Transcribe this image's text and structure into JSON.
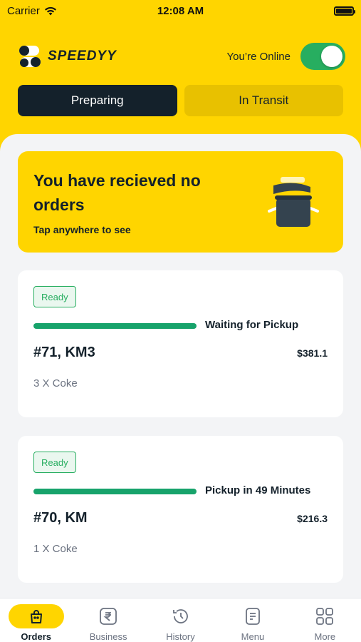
{
  "status_bar": {
    "carrier": "Carrier",
    "time": "12:08 AM"
  },
  "header": {
    "brand": "SPEEDYY",
    "online_label": "You’re Online",
    "online": true
  },
  "tabs": [
    {
      "label": "Preparing",
      "active": true
    },
    {
      "label": "In Transit",
      "active": false
    }
  ],
  "banner": {
    "title": "You have recieved no orders",
    "subtitle": "Tap anywhere to see",
    "icon": "cooking-pot-icon"
  },
  "orders": [
    {
      "badge": "Ready",
      "status": "Waiting for Pickup",
      "id": "#71, KM3",
      "price": "$381.1",
      "items": "3 X Coke",
      "progress": 1.0
    },
    {
      "badge": "Ready",
      "status": "Pickup in 49 Minutes",
      "id": "#70, KM",
      "price": "$216.3",
      "items": "1 X Coke",
      "progress": 1.0
    }
  ],
  "nav": [
    {
      "label": "Orders",
      "icon": "bag-icon",
      "active": true
    },
    {
      "label": "Business",
      "icon": "rupee-icon",
      "active": false
    },
    {
      "label": "History",
      "icon": "history-icon",
      "active": false
    },
    {
      "label": "Menu",
      "icon": "menu-doc-icon",
      "active": false
    },
    {
      "label": "More",
      "icon": "grid-icon",
      "active": false
    }
  ],
  "colors": {
    "brand_yellow": "#FFD500",
    "dark": "#14212B",
    "green": "#27AE60"
  }
}
